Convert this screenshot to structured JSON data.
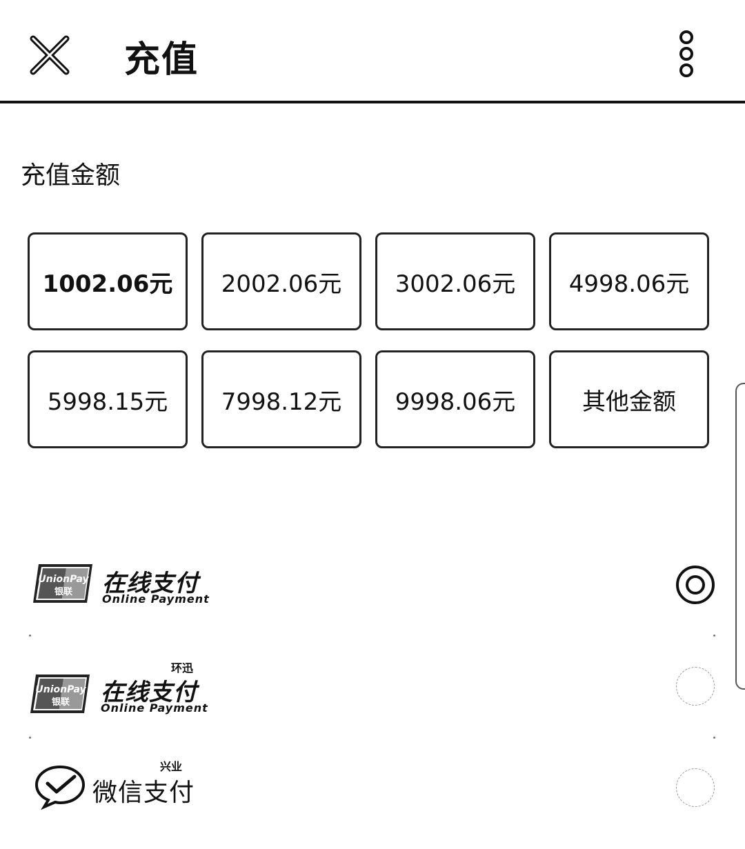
{
  "header": {
    "title": "充值",
    "close_icon": "close-icon",
    "more_icon": "more-vertical-icon"
  },
  "amount": {
    "label": "充值金额",
    "options": [
      {
        "label": "1002.06元",
        "selected": true
      },
      {
        "label": "2002.06元",
        "selected": false
      },
      {
        "label": "3002.06元",
        "selected": false
      },
      {
        "label": "4998.06元",
        "selected": false
      },
      {
        "label": "5998.15元",
        "selected": false
      },
      {
        "label": "7998.12元",
        "selected": false
      },
      {
        "label": "9998.06元",
        "selected": false
      },
      {
        "label": "其他金额",
        "selected": false
      }
    ]
  },
  "payment": {
    "methods": [
      {
        "logo_text": "UnionPay 银联",
        "title": "在线支付",
        "subtitle": "Online Payment",
        "tag": "",
        "selected": true
      },
      {
        "logo_text": "UnionPay 银联",
        "title": "在线支付",
        "subtitle": "Online Payment",
        "tag": "环迅",
        "selected": false
      },
      {
        "logo_text": "",
        "title": "微信支付",
        "subtitle": "",
        "tag": "兴业",
        "selected": false
      }
    ]
  }
}
